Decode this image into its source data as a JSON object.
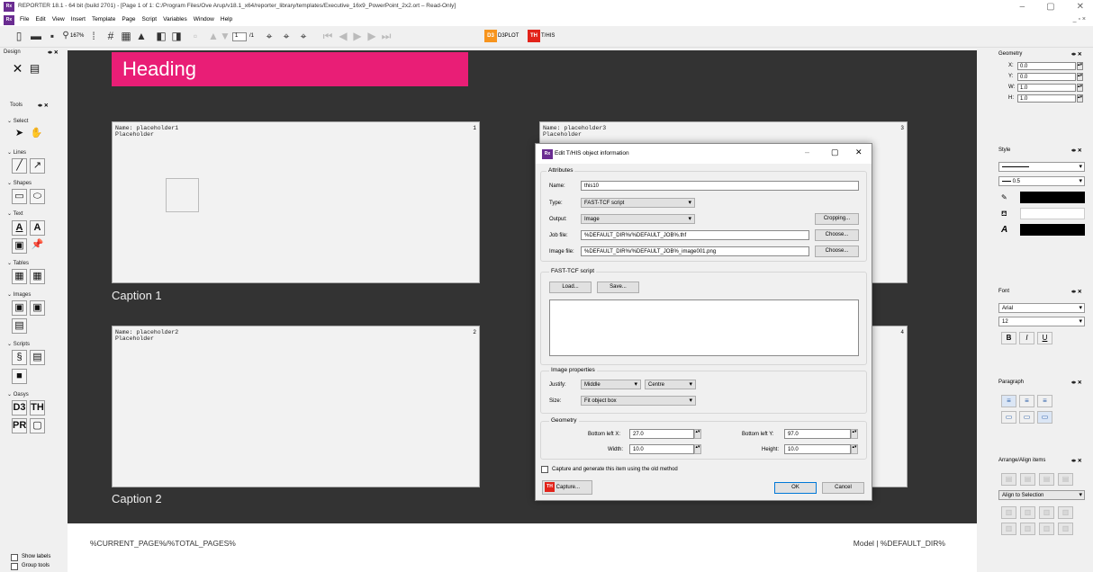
{
  "window": {
    "title": "REPORTER 18.1 - 64 bit (build 2701) - [Page 1 of 1: C:/Program Files/Ove Arup/v18.1_x64/reporter_library/templates/Executive_16x9_PowerPoint_2x2.ort – Read-Only]",
    "app_icon": "Rx",
    "minimize": "–",
    "maximize": "▢",
    "close": "✕",
    "mdi_controls": "_ ▫ ×"
  },
  "menu": [
    "File",
    "Edit",
    "View",
    "Insert",
    "Template",
    "Page",
    "Script",
    "Variables",
    "Window",
    "Help"
  ],
  "toolbar": {
    "zoom": "167%",
    "page_input": "1",
    "page_total": "/1",
    "d3plot_label": "D3PLOT",
    "this_label": "T/HIS",
    "d3_icon": "D3",
    "th_icon": "TH"
  },
  "left": {
    "design_title": "Design",
    "tools_title": "Tools",
    "sections": [
      "Select",
      "Lines",
      "Shapes",
      "Text",
      "Tables",
      "Images",
      "Scripts",
      "Oasys"
    ],
    "oasys_icons": [
      "D3",
      "TH",
      "PR"
    ],
    "show_labels": "Show labels",
    "group_tools": "Group tools"
  },
  "page": {
    "heading": "Heading",
    "placeholders": [
      {
        "name": "Name: placeholder1\nPlaceholder",
        "num": "1"
      },
      {
        "name": "Name: placeholder2\nPlaceholder",
        "num": "2"
      },
      {
        "name": "Name: placeholder3\nPlaceholder",
        "num": "3"
      },
      {
        "name": "",
        "num": "4"
      }
    ],
    "caption1": "Caption 1",
    "caption2": "Caption 2",
    "footer_left": "%CURRENT_PAGE%/%TOTAL_PAGES%",
    "footer_right": "Model | %DEFAULT_DIR%"
  },
  "right": {
    "geometry_title": "Geometry",
    "x_label": "X:",
    "x_value": "0.0",
    "y_label": "Y:",
    "y_value": "0.0",
    "w_label": "W:",
    "w_value": "1.0",
    "h_label": "H:",
    "h_value": "1.0",
    "style_title": "Style",
    "line_width": "0.5",
    "font_title": "Font",
    "font_name": "Arial",
    "font_size": "12",
    "bold": "B",
    "italic": "I",
    "underline": "U",
    "paragraph_title": "Paragraph",
    "arrange_title": "Arrange/Align items",
    "align_to": "Align to Selection"
  },
  "dialog": {
    "title": "Edit T/HIS object information",
    "attributes": "Attributes",
    "name_label": "Name:",
    "name_value": "this10",
    "type_label": "Type:",
    "type_value": "FAST-TCF script",
    "output_label": "Output:",
    "output_value": "Image",
    "cropping": "Cropping...",
    "job_label": "Job file:",
    "job_value": "%DEFAULT_DIR%/%DEFAULT_JOB%.thf",
    "image_label": "Image file:",
    "image_value": "%DEFAULT_DIR%/%DEFAULT_JOB%_image001.png",
    "choose": "Choose...",
    "fast_tcf": "FAST-TCF script",
    "load": "Load...",
    "save": "Save...",
    "image_props": "Image properties",
    "justify_label": "Justify:",
    "justify_v": "Middle",
    "justify_h": "Centre",
    "size_label": "Size:",
    "size_value": "Fit object box",
    "geometry": "Geometry",
    "blx_label": "Bottom left X:",
    "blx": "27.0",
    "bly_label": "Bottom left Y:",
    "bly": "97.0",
    "width_label": "Width:",
    "width": "10.0",
    "height_label": "Height:",
    "height": "10.0",
    "capture_old": "Capture and generate this item using the old method",
    "capture": "Capture...",
    "ok": "OK",
    "cancel": "Cancel"
  },
  "colors": {
    "heading": "#e91e76",
    "canvas": "#333333",
    "d3": "#f7941d",
    "th": "#e2231a"
  }
}
